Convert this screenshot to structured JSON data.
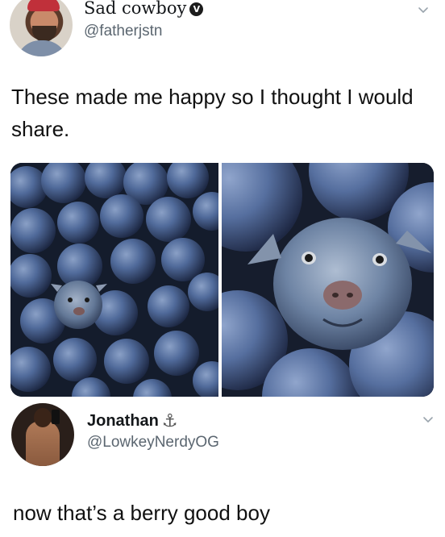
{
  "tweet": {
    "display_name": "Sad cowboy",
    "verified_glyph": "V",
    "handle": "@fatherjstn",
    "text": "These made me happy so I thought I would share.",
    "media": [
      {
        "name": "blueberries-with-dog-zoomed-out"
      },
      {
        "name": "blueberries-with-dog-close-up"
      }
    ]
  },
  "reply": {
    "display_name": "Jonathan",
    "name_emoji": "⚓",
    "handle": "@LowkeyNerdyOG",
    "text": "now that’s a berry good boy"
  },
  "icons": {
    "verified": "verified-badge-icon",
    "more": "chevron-down-icon",
    "anchor": "anchor-emoji-icon"
  },
  "colors": {
    "text": "#14171a",
    "handle": "#5b6670",
    "blueberry": "#3f5683"
  }
}
